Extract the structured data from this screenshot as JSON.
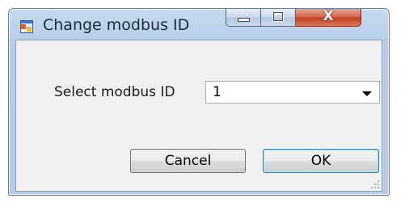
{
  "window": {
    "title": "Change modbus ID",
    "icon": "application-icon"
  },
  "caption_buttons": {
    "minimize_icon": "minimize-icon",
    "maximize_icon": "maximize-icon",
    "close_label": "X"
  },
  "form": {
    "label": "Select modbus ID",
    "selected_value": "1"
  },
  "buttons": {
    "cancel_label": "Cancel",
    "ok_label": "OK"
  },
  "colors": {
    "frame": "#b7cee8",
    "close_button": "#c4401f",
    "client_background": "#f0f0f0",
    "default_button_border": "#3c7fb1"
  }
}
